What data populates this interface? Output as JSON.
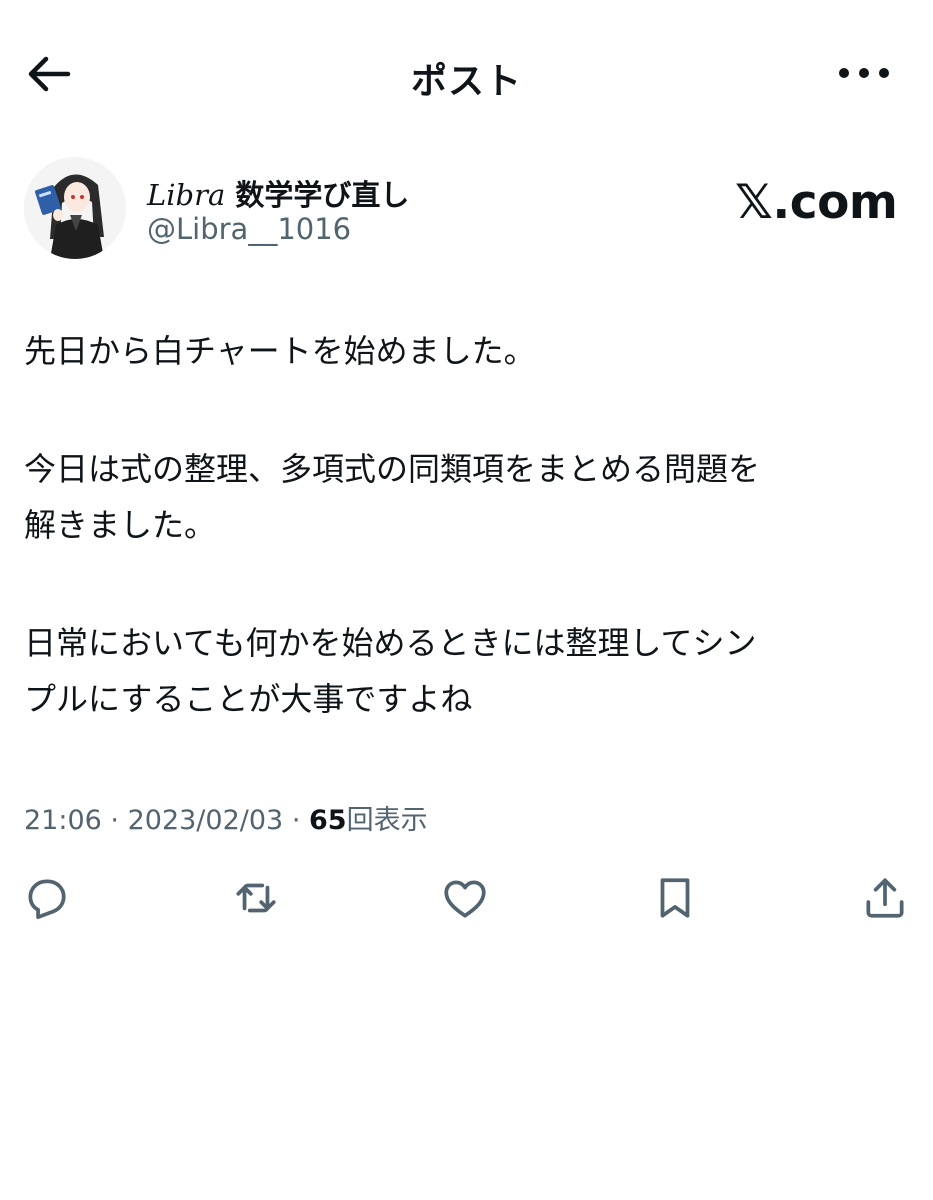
{
  "header": {
    "title": "ポスト",
    "back_icon": "arrow-left-icon",
    "more_icon": "more-horizontal-icon"
  },
  "author": {
    "display_name_latin": "Libra",
    "display_name_jp": "数学学び直し",
    "handle": "@Libra__1016"
  },
  "watermark": "𝕏.com",
  "tweet": {
    "paragraph1": [
      "先日から白チャートを始めました。"
    ],
    "paragraph2": [
      "今日は式の整理、多項式の同類項をまとめる問題を",
      "解きました。"
    ],
    "paragraph3": [
      "日常においても何かを始めるときには整理してシン",
      "プルにすることが大事ですよね"
    ]
  },
  "meta": {
    "time": "21:06",
    "separator": "·",
    "date": "2023/02/03",
    "views_count": "65",
    "views_label": "回表示"
  },
  "actions": {
    "icons": [
      "reply-icon",
      "retweet-icon",
      "like-icon",
      "bookmark-icon",
      "share-icon"
    ],
    "icon_color": "#536471"
  },
  "colors": {
    "text": "#0f1419",
    "secondary": "#536471",
    "background": "#ffffff"
  }
}
